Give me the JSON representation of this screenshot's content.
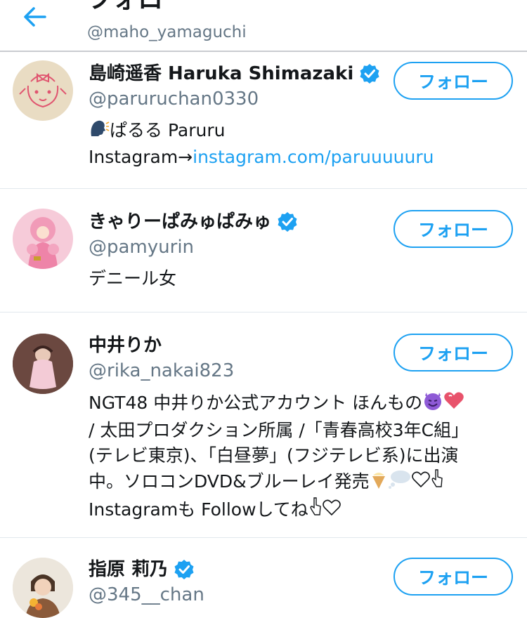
{
  "header": {
    "title": "フォロー",
    "handle": "@maho_yamaguchi",
    "back_icon": "back-arrow-icon"
  },
  "accent_color": "#1da1f2",
  "users": [
    {
      "name": "島崎遥香 Haruka Shimazaki",
      "handle": "@paruruchan0330",
      "verified": true,
      "bio_line1": "ぱるる Paruru",
      "bio_line2_prefix": "Instagram→",
      "bio_line2_link": "instagram.com/paruuuuuru",
      "follow_label": "フォロー"
    },
    {
      "name": "きゃりーぱみゅぱみゅ",
      "handle": "@pamyurin",
      "verified": true,
      "bio_line1": "デニール女",
      "follow_label": "フォロー"
    },
    {
      "name": "中井りか",
      "handle": "@rika_nakai823",
      "verified": false,
      "bio_line1": "NGT48 中井りか公式アカウント ほんもの",
      "bio_line2": "/ 太田プロダクション所属 /「青春高校3年C組」",
      "bio_line3": "(テレビ東京)、「白昼夢」(フジテレビ系)に出演",
      "bio_line4": "中。ソロコンDVD&ブルーレイ発売",
      "bio_line5": "Instagramも Followしてね",
      "follow_label": "フォロー"
    },
    {
      "name": "指原 莉乃",
      "handle": "@345__chan",
      "verified": true,
      "follow_label": "フォロー"
    }
  ]
}
